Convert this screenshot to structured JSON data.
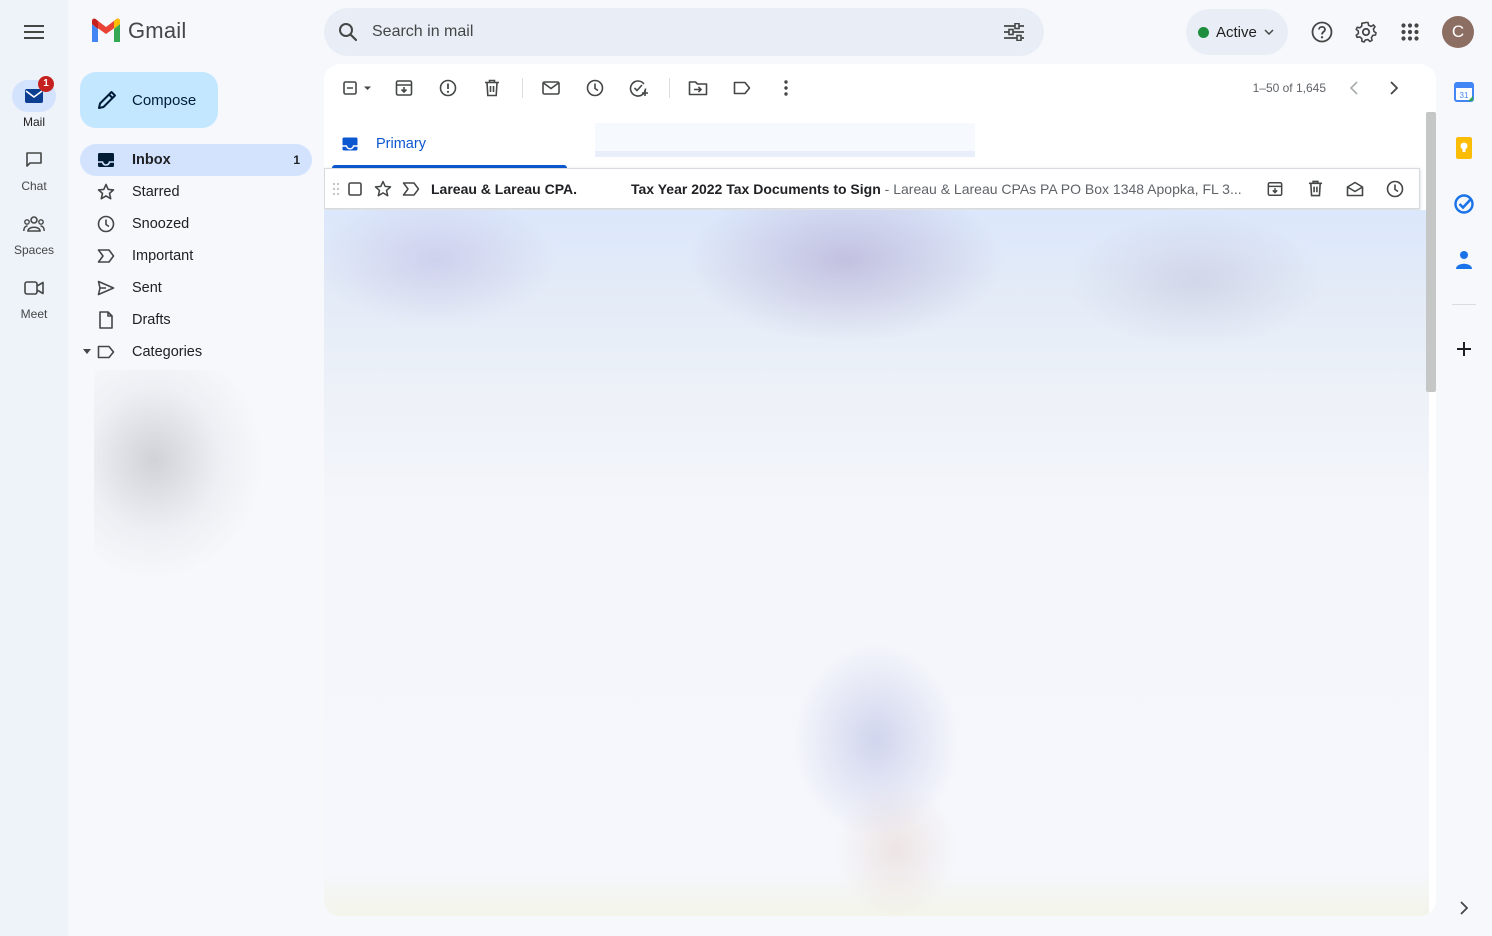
{
  "app": {
    "name": "Gmail"
  },
  "rail": {
    "items": [
      {
        "label": "Mail",
        "badge": "1"
      },
      {
        "label": "Chat"
      },
      {
        "label": "Spaces"
      },
      {
        "label": "Meet"
      }
    ]
  },
  "search": {
    "placeholder": "Search in mail"
  },
  "status": {
    "label": "Active",
    "color": "#1e8e3e"
  },
  "account": {
    "initial": "C"
  },
  "compose": {
    "label": "Compose"
  },
  "nav": {
    "items": [
      {
        "label": "Inbox",
        "count": "1",
        "icon": "inbox-icon"
      },
      {
        "label": "Starred",
        "icon": "star-icon"
      },
      {
        "label": "Snoozed",
        "icon": "clock-icon"
      },
      {
        "label": "Important",
        "icon": "important-icon"
      },
      {
        "label": "Sent",
        "icon": "send-icon"
      },
      {
        "label": "Drafts",
        "icon": "draft-icon"
      },
      {
        "label": "Categories",
        "icon": "label-icon"
      }
    ]
  },
  "toolbar": {
    "pager": "1–50 of 1,645"
  },
  "tabs": [
    {
      "label": "Primary",
      "active": true
    }
  ],
  "emails": [
    {
      "sender": "Lareau & Lareau CPA.",
      "subject": "Tax Year 2022 Tax Documents to Sign",
      "snippet": " - Lareau & Lareau CPAs PA PO Box 1348 Apopka, FL 3..."
    }
  ],
  "colors": {
    "accent": "#0b57d0",
    "compose_bg": "#c2e7ff",
    "active_bg": "#d3e3fd",
    "badge": "#c5221f"
  }
}
